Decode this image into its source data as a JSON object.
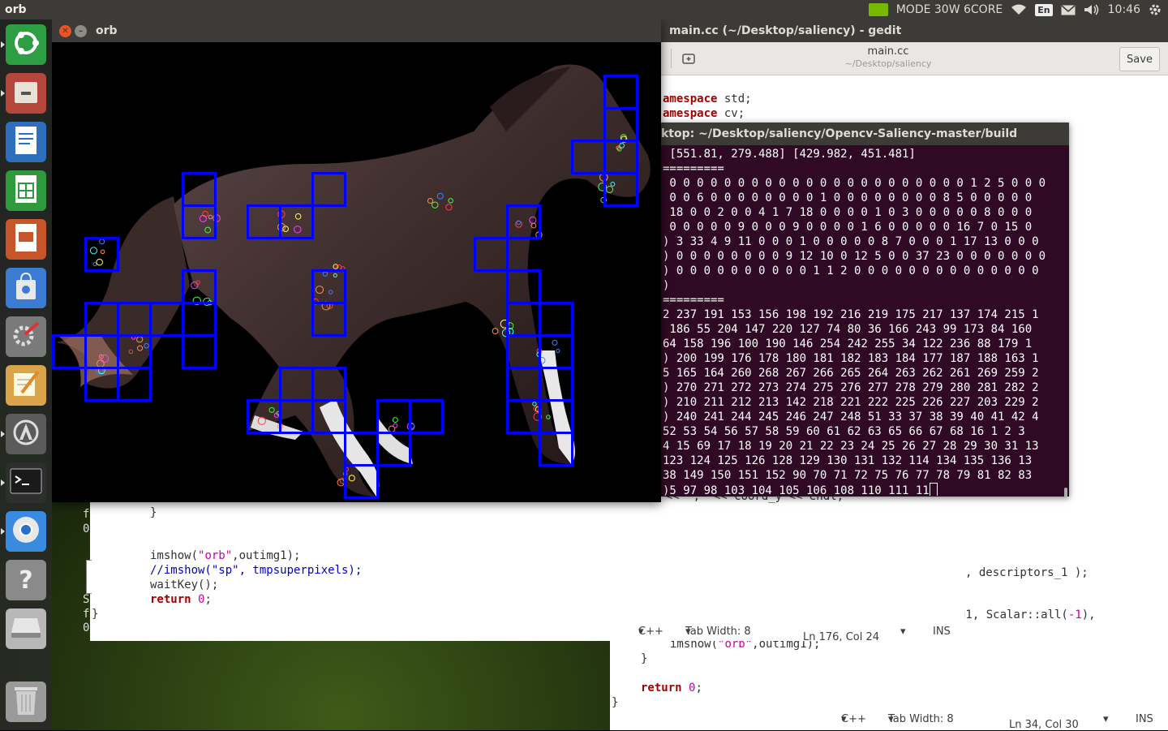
{
  "top_panel": {
    "app_name": "orb",
    "nvidia_mode": "MODE 30W 6CORE",
    "keyboard_lang": "En",
    "clock": "10:46"
  },
  "launcher": {
    "items": [
      {
        "name": "ubuntu-dash",
        "color": "#2d9e43"
      },
      {
        "name": "files",
        "color": "#b4463c"
      },
      {
        "name": "writer",
        "color": "#2d6fbd"
      },
      {
        "name": "calc",
        "color": "#2f9a3b"
      },
      {
        "name": "impress",
        "color": "#c6562a"
      },
      {
        "name": "software",
        "color": "#3b7bd1"
      },
      {
        "name": "settings",
        "color": "#7a7a7a"
      },
      {
        "name": "text-editor",
        "color": "#d9a44a"
      },
      {
        "name": "updater",
        "color": "#5b5b5b"
      },
      {
        "name": "terminal",
        "color": "#2e2e2e"
      },
      {
        "name": "chromium",
        "color": "#3a8be0"
      },
      {
        "name": "help",
        "color": "#8a8a8a"
      },
      {
        "name": "drive",
        "color": "#b8b8b8"
      },
      {
        "name": "trash",
        "color": "#9a9a9a"
      }
    ]
  },
  "gedit": {
    "window_title": "main.cc (~/Desktop/saliency) - gedit",
    "doc_title": "main.cc",
    "doc_path": "~/Desktop/saliency",
    "save_label": "Save",
    "code_top": {
      "l1_kw": "amespace",
      "l1_rest": " std;",
      "l2_kw": "amespace",
      "l2_rest": " cv;"
    },
    "status_main": {
      "lang": "C++",
      "tab": "Tab Width: 8",
      "pos": "Ln 176, Col 24",
      "ins": "INS"
    }
  },
  "gedit_back": {
    "line_desc": ", descriptors_1 );",
    "line_scalar_pre": "g1, Scalar::all(",
    "line_scalar_num": "-1",
    "line_scalar_post": "),",
    "line_imshow_pre": "imshow(",
    "line_imshow_str": "\"orb\"",
    "line_imshow_post": ",outimg1);",
    "brace1": "}",
    "return_kw": "return",
    "return_num": "0",
    "brace2": "}",
    "status": {
      "lang": "C++",
      "tab": "Tab Width: 8",
      "pos": "Ln 34, Col 30",
      "ins": "INS"
    }
  },
  "gedit_mid": {
    "partial_line": "x << \",  << coord_y << endl;",
    "brace_close": "}",
    "imshow_pre": "imshow(",
    "imshow_str": "\"orb\"",
    "imshow_post": ",outimg1);",
    "imshow2_comment": "//imshow(\"sp\", tmpsuperpixels);",
    "waitkey": "waitKey();",
    "return_kw": "return",
    "return_num": "0",
    "brace_end": "}",
    "left_frags": [
      "f",
      "0",
      "S",
      "f",
      "0"
    ]
  },
  "terminal": {
    "title": "ktop: ~/Desktop/saliency/Opencv-Saliency-master/build",
    "lines": [
      " [551.81, 279.488] [429.982, 451.481]",
      "=========",
      " 0 0 0 0 0 0 0 0 0 0 0 0 0 0 0 0 0 0 0 0 0 0 1 2 5 0 0 0",
      " 0 0 6 0 0 0 0 0 0 0 0 1 0 0 0 0 0 0 0 0 8 5 0 0 0 0 0",
      " 18 0 0 2 0 0 4 1 7 18 0 0 0 0 1 0 3 0 0 0 0 0 8 0 0 0",
      " 0 0 0 0 0 9 0 0 0 9 0 0 0 0 1 6 0 0 0 0 0 16 7 0 15 0",
      ") 3 33 4 9 11 0 0 0 1 0 0 0 0 0 8 7 0 0 0 1 17 13 0 0 0",
      ") 0 0 0 0 0 0 0 0 9 12 10 0 12 5 0 0 37 23 0 0 0 0 0 0 0",
      ") 0 0 0 0 0 0 0 0 0 0 1 1 2 0 0 0 0 0 0 0 0 0 0 0 0 0 0",
      ")",
      "=========",
      "2 237 191 153 156 198 192 216 219 175 217 137 174 215 1",
      " 186 55 204 147 220 127 74 80 36 166 243 99 173 84 160",
      "64 158 196 100 190 146 254 242 255 34 122 236 88 179 1",
      ") 200 199 176 178 180 181 182 183 184 177 187 188 163 1",
      "5 165 164 260 268 267 266 265 264 263 262 261 269 259 2",
      ") 270 271 272 273 274 275 276 277 278 279 280 281 282 2",
      ") 210 211 212 213 142 218 221 222 225 226 227 203 229 2",
      ") 240 241 244 245 246 247 248 51 33 37 38 39 40 41 42 4",
      "52 53 54 56 57 58 59 60 61 62 63 65 66 67 68 16 1 2 3",
      "4 15 69 17 18 19 20 21 22 23 24 25 26 27 28 29 30 31 13",
      "123 124 125 126 128 129 130 131 132 114 134 135 136 13",
      "38 149 150 151 152 90 70 71 72 75 76 77 78 79 81 82 83",
      ")5 97 98 103 104 105 106 108 110 111 11"
    ]
  },
  "orb_window": {
    "title": "orb",
    "box_color": "#0000ff",
    "horse_color": "#3b2a2a"
  }
}
